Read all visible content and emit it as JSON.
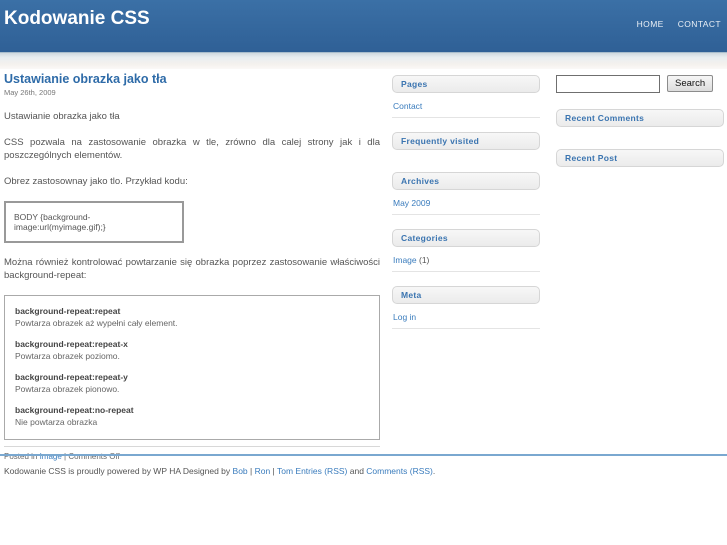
{
  "header": {
    "site_title": "Kodowanie CSS",
    "nav": [
      {
        "label": "HOME"
      },
      {
        "label": "CONTACT"
      }
    ]
  },
  "post": {
    "title": "Ustawianie obrazka jako tła",
    "date": "May 26th, 2009",
    "paragraph1": "Ustawianie obrazka jako tła",
    "paragraph2": "CSS pozwala na zastosowanie obrazka w tle, zrówno dla calej strony jak i dla poszczególnych elementów.",
    "paragraph3": "Obrez zastosownay jako tlo. Przykład kodu:",
    "code": "BODY {background-image:url(myimage.gif);}",
    "paragraph4": "Można również kontrolować powtarzanie się obrazka poprzez zastosowanie właściwości background-repeat:",
    "repeat_items": [
      {
        "property": "background-repeat:repeat",
        "description": "Powtarza obrazek aż wypełni cały element."
      },
      {
        "property": "background-repeat:repeat-x",
        "description": "Powtarza obrazek poziomo."
      },
      {
        "property": "background-repeat:repeat-y",
        "description": "Powtarza obrazek pionowo."
      },
      {
        "property": "background-repeat:no-repeat",
        "description": "Nie powtarza obrazka"
      }
    ],
    "meta_prefix": "Posted in ",
    "meta_category": "Image",
    "meta_suffix": " | Comments Off"
  },
  "sidebar_left": {
    "widgets": [
      {
        "title": "Pages",
        "items": [
          {
            "label": "Contact",
            "count": ""
          }
        ]
      },
      {
        "title": "Frequently visited",
        "items": []
      },
      {
        "title": "Archives",
        "items": [
          {
            "label": "May 2009",
            "count": ""
          }
        ]
      },
      {
        "title": "Categories",
        "items": [
          {
            "label": "Image",
            "count": " (1)"
          }
        ]
      },
      {
        "title": "Meta",
        "items": [
          {
            "label": "Log in",
            "count": ""
          }
        ]
      }
    ]
  },
  "sidebar_right": {
    "search": {
      "value": "",
      "placeholder": "",
      "button_label": "Search"
    },
    "widgets": [
      {
        "title": "Recent Comments",
        "items": []
      },
      {
        "title": "Recent Post",
        "items": []
      }
    ]
  },
  "footer": {
    "text_start": "Kodowanie CSS is proudly powered by WP HA Designed by ",
    "link_bob": "Bob",
    "sep1": " | ",
    "link_ron": "Ron",
    "sep2": " | ",
    "link_tom": "Tom",
    "sep3": " ",
    "link_entries": "Entries (RSS)",
    "sep4": " and ",
    "link_comments": "Comments (RSS)",
    "sep5": "."
  },
  "colors": {
    "header_blue": "#35699f",
    "link_blue": "#3a7cbd",
    "title_blue": "#2e6ba8",
    "footer_border": "#7aa8d0"
  }
}
